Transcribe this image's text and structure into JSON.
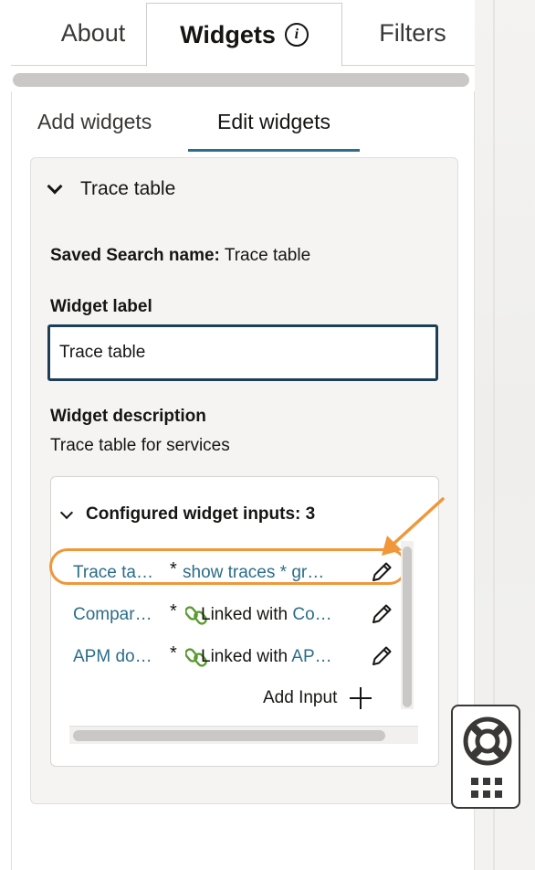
{
  "tabs": [
    {
      "label": "About"
    },
    {
      "label": "Widgets"
    },
    {
      "label": "Filters"
    }
  ],
  "sub_tabs": [
    {
      "label": "Add widgets"
    },
    {
      "label": "Edit widgets"
    }
  ],
  "widget": {
    "section_title": "Trace table",
    "saved_search_label": "Saved Search name:",
    "saved_search_value": "Trace table",
    "label_title": "Widget label",
    "label_value": "Trace table",
    "description_title": "Widget description",
    "description_value": "Trace table for services"
  },
  "inputs": {
    "header": "Configured widget inputs: 3",
    "rows": [
      {
        "name": "Trace ta…",
        "star": "*",
        "mapping_prefix": "",
        "mapping_value": "show traces * gr…",
        "linked": false
      },
      {
        "name": "Compar…",
        "star": "*",
        "mapping_prefix": "Linked with ",
        "mapping_value": "Co…",
        "linked": true
      },
      {
        "name": "APM do…",
        "star": "*",
        "mapping_prefix": "Linked with ",
        "mapping_value": "AP…",
        "linked": true
      }
    ],
    "add_label": "Add Input"
  },
  "colors": {
    "link_blue": "#2b6d8a",
    "highlight_orange": "#f0973a",
    "link_icon_green": "#5b9b32"
  },
  "icons": {
    "info": "info-icon",
    "edit": "pencil-icon",
    "link": "chain-link-icon",
    "add": "plus-icon",
    "help": "life-buoy-icon",
    "apps": "grid-icon"
  }
}
